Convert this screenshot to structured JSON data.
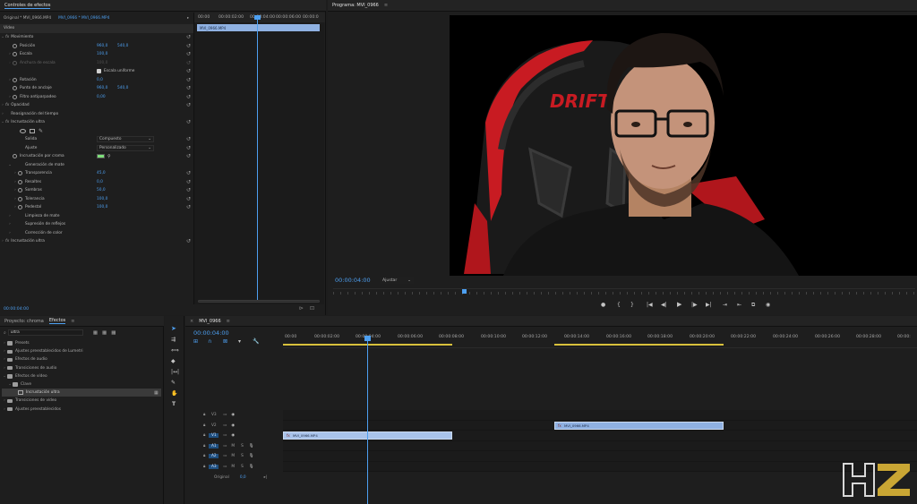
{
  "effect_controls": {
    "tab_title": "Controles de efectos",
    "source_label": "Original * MVI_0966.MP4",
    "clip_label": "MVI_0966 * MVI_0966.MP4",
    "mini_timeline": [
      "00:00",
      "00:00:02:00",
      "00:00:04:00",
      "00:00:06:00",
      "00:00:0"
    ],
    "clip_chip": "MVI_0966.MP4",
    "section_video": "Vídeo",
    "rows": [
      {
        "label": "Movimiento",
        "kind": "fx"
      },
      {
        "label": "Posición",
        "v1": "960,0",
        "v2": "540,0"
      },
      {
        "label": "Escala",
        "v1": "100,0"
      },
      {
        "label": "Anchura de escala",
        "v1": "100,0",
        "disabled": true
      },
      {
        "label": "Escala uniforme",
        "kind": "checkbox"
      },
      {
        "label": "Rotación",
        "v1": "0,0"
      },
      {
        "label": "Punto de anclaje",
        "v1": "960,0",
        "v2": "540,0"
      },
      {
        "label": "Filtro antiparpadeo",
        "v1": "0,00"
      },
      {
        "label": "Opacidad",
        "kind": "fx"
      },
      {
        "label": "Reasignación del tiempo",
        "kind": "fx"
      },
      {
        "label": "Incrustación ultra",
        "kind": "fx"
      },
      {
        "label": "",
        "kind": "masks"
      },
      {
        "label": "Salida",
        "dropdown": "Compuesto"
      },
      {
        "label": "Ajuste",
        "dropdown": "Personalizado"
      },
      {
        "label": "Incrustación por croma",
        "kind": "swatch"
      },
      {
        "label": "Generación de mate",
        "kind": "group"
      },
      {
        "label": "Transparencia",
        "v1": "45,0"
      },
      {
        "label": "Resaltes",
        "v1": "0,0"
      },
      {
        "label": "Sombras",
        "v1": "50,0"
      },
      {
        "label": "Tolerancia",
        "v1": "100,0"
      },
      {
        "label": "Pedestal",
        "v1": "100,0"
      },
      {
        "label": "Limpieza de mate",
        "kind": "group"
      },
      {
        "label": "Supresión de reflejos",
        "kind": "group"
      },
      {
        "label": "Corrección de color",
        "kind": "group"
      },
      {
        "label": "Incrustación ultra",
        "kind": "fx"
      }
    ],
    "timecode": "00:00:04:00"
  },
  "program": {
    "tab_title": "Programa: MVI_0966",
    "timecode": "00:00:04:00",
    "fit_label": "Ajustar",
    "chair_brand": "DRIFT",
    "transport_icons": [
      "marker-icon",
      "in-point-icon",
      "out-point-icon",
      "go-to-in-icon",
      "step-back-icon",
      "play-icon",
      "step-forward-icon",
      "go-to-out-icon",
      "lift-icon",
      "extract-icon",
      "export-frame-icon",
      "settings-icon"
    ],
    "transport_glyphs": [
      "●",
      "{",
      "}",
      "|◀",
      "◀|",
      "▶",
      "|▶",
      "▶|",
      "⇥",
      "⇤",
      "⧉",
      "◉"
    ]
  },
  "project": {
    "tab_project": "Proyecto: chroma",
    "tab_effects": "Efectos",
    "search_value": "ultra",
    "tree": [
      {
        "label": "Presets",
        "indent": 0
      },
      {
        "label": "Ajustes preestablecidos de Lumetri",
        "indent": 0
      },
      {
        "label": "Efectos de audio",
        "indent": 0
      },
      {
        "label": "Transiciones de audio",
        "indent": 0
      },
      {
        "label": "Efectos de vídeo",
        "indent": 0,
        "open": true
      },
      {
        "label": "Clave",
        "indent": 1,
        "open": true
      },
      {
        "label": "Incrustación ultra",
        "indent": 2,
        "selected": true
      },
      {
        "label": "Transiciones de vídeo",
        "indent": 0
      },
      {
        "label": "Ajustes preestablecidos",
        "indent": 0
      }
    ]
  },
  "timeline": {
    "tab_title": "MVI_0966",
    "timecode": "00:00:04:00",
    "ruler": [
      "00:00",
      "00:00:02:00",
      "00:00:04:00",
      "00:00:06:00",
      "00:00:08:00",
      "00:00:10:00",
      "00:00:12:00",
      "00:00:14:00",
      "00:00:16:00",
      "00:00:18:00",
      "00:00:20:00",
      "00:00:22:00",
      "00:00:24:00",
      "00:00:26:00",
      "00:00:28:00",
      "00:00:"
    ],
    "tracks": [
      {
        "name": "V3",
        "type": "video"
      },
      {
        "name": "V2",
        "type": "video"
      },
      {
        "name": "V1",
        "type": "video",
        "active": true
      },
      {
        "name": "A1",
        "type": "audio"
      },
      {
        "name": "A2",
        "type": "audio"
      },
      {
        "name": "A3",
        "type": "audio"
      }
    ],
    "track_letters": {
      "mute": "M",
      "solo": "S"
    },
    "master_label": "Original",
    "master_value": "0,0",
    "clip_v2": "MVI_0966.MP4",
    "clip_v1": "MVI_0966.MP4"
  },
  "watermark": "HZ"
}
